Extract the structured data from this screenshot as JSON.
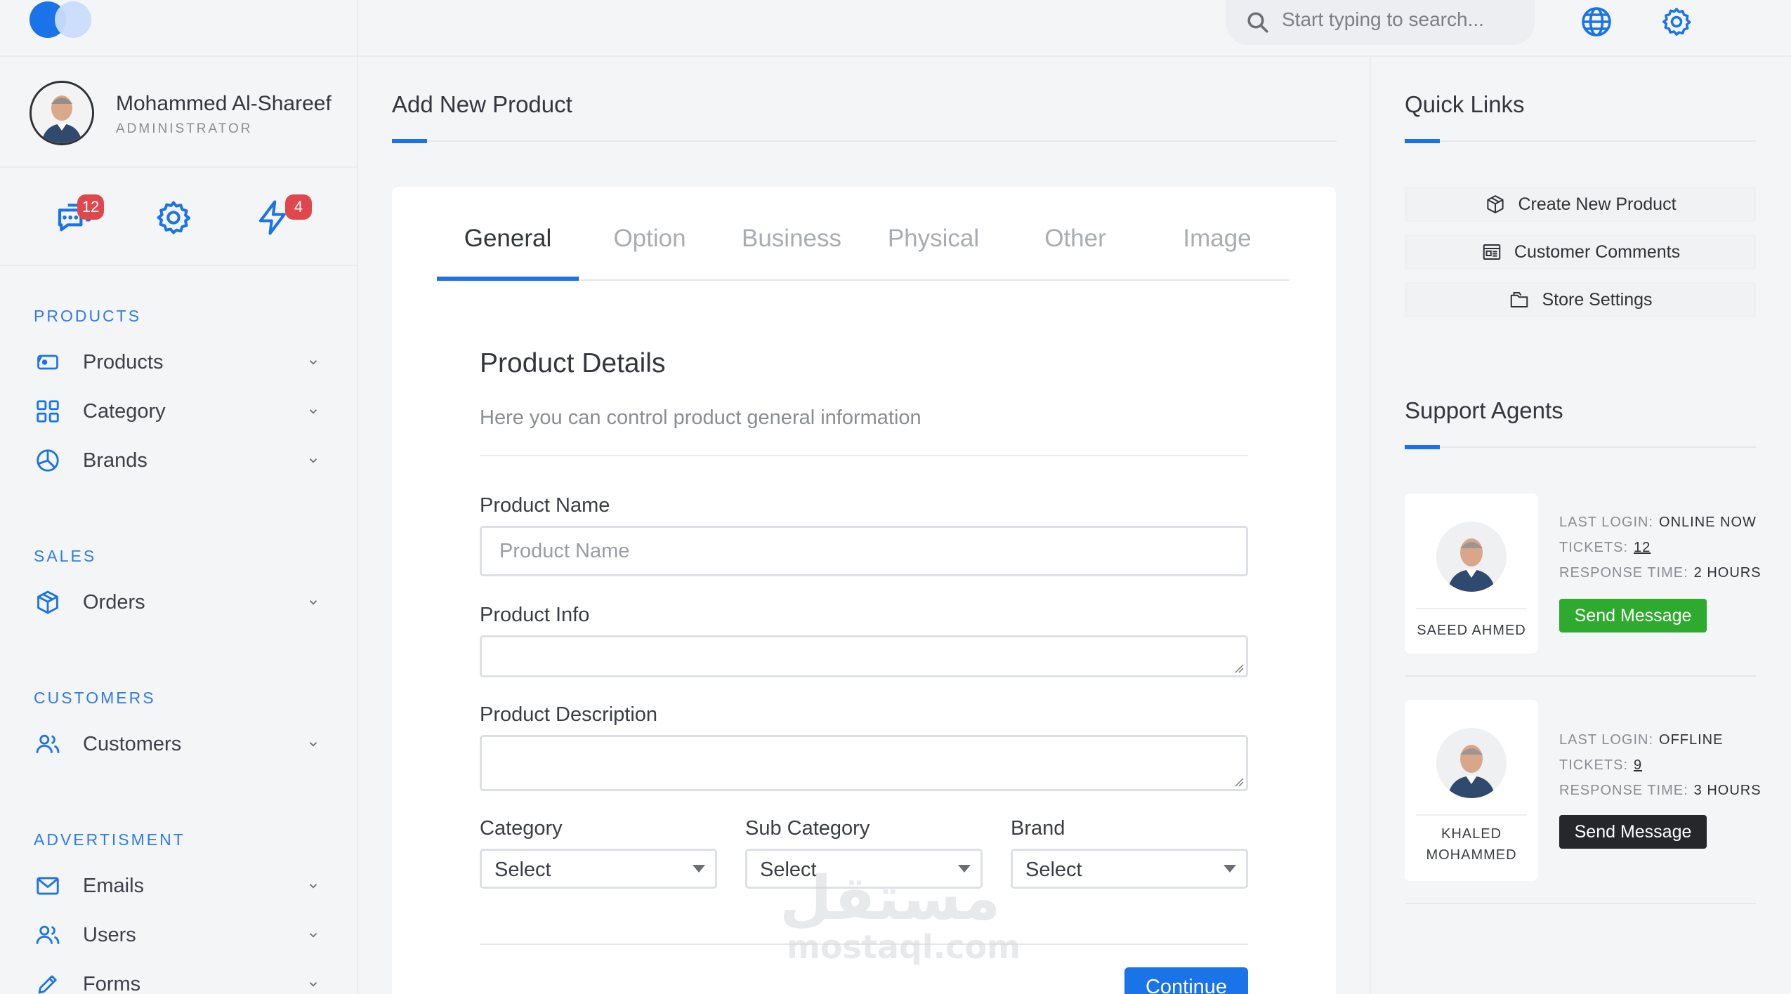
{
  "header": {
    "search_placeholder": "Start typing to search..."
  },
  "user": {
    "name": "Mohammed Al-Shareef",
    "role": "ADMINISTRATOR"
  },
  "quick_icons": {
    "messages_badge": "12",
    "alerts_badge": "4"
  },
  "sidebar": {
    "sections": [
      {
        "title": "PRODUCTS",
        "items": [
          {
            "label": "Products",
            "icon": "tag-icon"
          },
          {
            "label": "Category",
            "icon": "grid-icon"
          },
          {
            "label": "Brands",
            "icon": "pie-chart-icon"
          }
        ]
      },
      {
        "title": "SALES",
        "items": [
          {
            "label": "Orders",
            "icon": "box-icon"
          }
        ]
      },
      {
        "title": "CUSTOMERS",
        "items": [
          {
            "label": "Customers",
            "icon": "users-icon"
          }
        ]
      },
      {
        "title": "ADVERTISMENT",
        "items": [
          {
            "label": "Emails",
            "icon": "mail-icon"
          },
          {
            "label": "Users",
            "icon": "users-icon"
          },
          {
            "label": "Forms",
            "icon": "pencil-icon"
          }
        ]
      }
    ]
  },
  "main": {
    "title": "Add New Product",
    "tabs": [
      "General",
      "Option",
      "Business",
      "Physical",
      "Other",
      "Image"
    ],
    "active_tab": "General",
    "section_title": "Product Details",
    "section_subtitle": "Here you can control product general information",
    "fields": {
      "product_name_label": "Product Name",
      "product_name_placeholder": "Product Name",
      "product_info_label": "Product Info",
      "product_description_label": "Product Description",
      "category_label": "Category",
      "category_value": "Select",
      "subcategory_label": "Sub Category",
      "subcategory_value": "Select",
      "brand_label": "Brand",
      "brand_value": "Select"
    },
    "continue_label": "Continue"
  },
  "watermark": {
    "arabic": "مستقل",
    "latin": "mostaql.com"
  },
  "quick_links": {
    "title": "Quick Links",
    "items": [
      {
        "label": "Create New Product",
        "icon": "box-icon"
      },
      {
        "label": "Customer Comments",
        "icon": "news-icon"
      },
      {
        "label": "Store Settings",
        "icon": "folder-icon"
      }
    ]
  },
  "support": {
    "title": "Support Agents",
    "agents": [
      {
        "name": "SAEED AHMED",
        "last_login_label": "LAST LOGIN:",
        "last_login": "ONLINE NOW",
        "tickets_label": "TICKETS:",
        "tickets": "12",
        "response_label": "RESPONSE TIME:",
        "response_time": "2 HOURS",
        "button": "Send Message",
        "button_color": "#2eaa2e"
      },
      {
        "name": "KHALED MOHAMMED",
        "last_login_label": "LAST LOGIN:",
        "last_login": "OFFLINE",
        "tickets_label": "TICKETS:",
        "tickets": "9",
        "response_label": "RESPONSE TIME:",
        "response_time": "3 HOURS",
        "button": "Send Message",
        "button_color": "#26272b"
      }
    ]
  },
  "colors": {
    "accent": "#1a73e8",
    "badge": "#e0474c"
  }
}
